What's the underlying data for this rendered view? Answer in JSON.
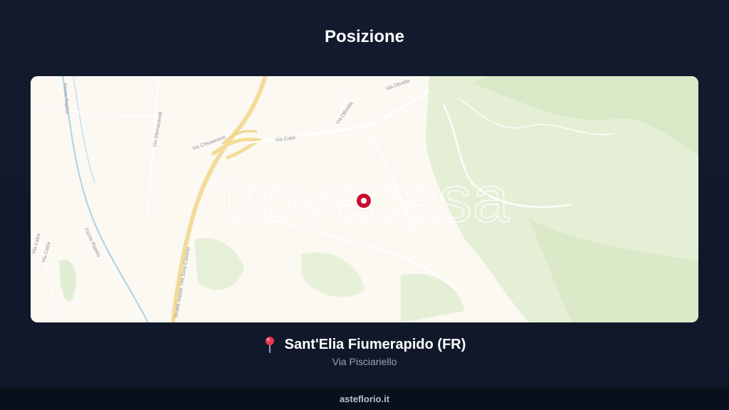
{
  "header": {
    "title": "Posizione"
  },
  "map": {
    "watermark": "trovacasa",
    "road_labels": [
      "Via Olivella",
      "Via Ollivella",
      "Via Cupe",
      "Via Chiusanova",
      "Via Sferracavalli",
      "Strada statale 749 Sora-Cassino",
      "Via Calce",
      "Via Calce",
      "Fiume Rapido",
      "Fiume Rapido"
    ],
    "colors": {
      "land": "#fcf8f2",
      "vegetation": "#e4efd6",
      "highway": "#f3dc99",
      "river": "#a9d3e8",
      "marker": "#c8102e"
    }
  },
  "location": {
    "pin_icon": "map-pin-icon",
    "name": "Sant'Elia Fiumerapido (FR)",
    "address": "Via Pisciariello"
  },
  "footer": {
    "site": "asteflorio.it"
  }
}
